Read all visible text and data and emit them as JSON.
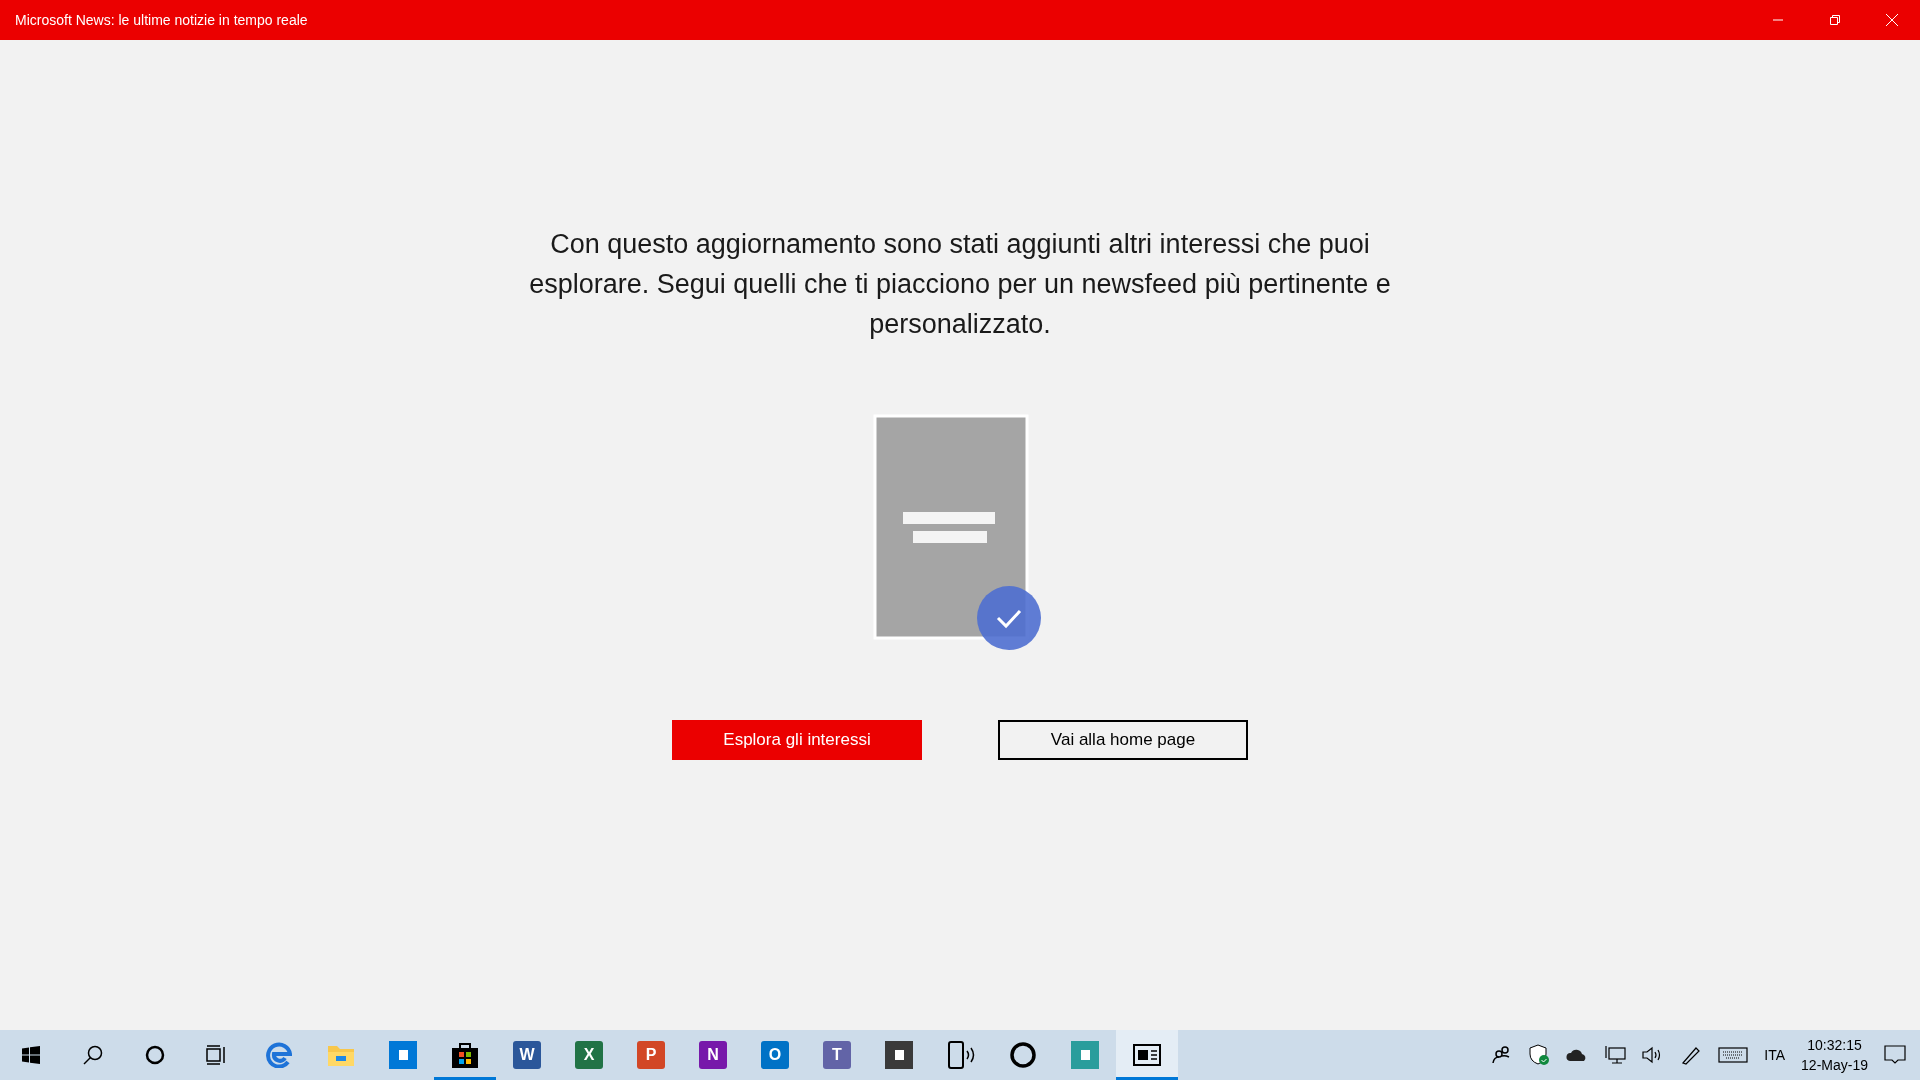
{
  "window": {
    "title": "Microsoft News: le ultime notizie in tempo reale"
  },
  "message": "Con questo aggiornamento sono stati aggiunti altri interessi che puoi esplorare. Segui quelli che ti piacciono per un newsfeed più pertinente e personalizzato.",
  "buttons": [
    {
      "kind": "primary",
      "label": "Esplora gli interessi"
    },
    {
      "kind": "outline",
      "label": "Vai alla home page"
    }
  ],
  "taskbar": {
    "apps": [
      {
        "kind": "start",
        "running": false,
        "selected": false
      },
      {
        "kind": "search",
        "running": false,
        "selected": false
      },
      {
        "kind": "cortana",
        "running": false,
        "selected": false
      },
      {
        "kind": "taskview",
        "running": false,
        "selected": false
      },
      {
        "kind": "edge",
        "running": false,
        "selected": false
      },
      {
        "kind": "folder",
        "running": false,
        "selected": false
      },
      {
        "kind": "tile",
        "color": "#0078d7",
        "running": false,
        "selected": false
      },
      {
        "kind": "store",
        "running": true,
        "selected": false
      },
      {
        "kind": "letter",
        "letter": "W",
        "color": "#2b579a",
        "running": false,
        "selected": false
      },
      {
        "kind": "letter",
        "letter": "X",
        "color": "#217346",
        "running": false,
        "selected": false
      },
      {
        "kind": "letter",
        "letter": "P",
        "color": "#d24726",
        "running": false,
        "selected": false
      },
      {
        "kind": "letter",
        "letter": "N",
        "color": "#7719aa",
        "running": false,
        "selected": false
      },
      {
        "kind": "letter",
        "letter": "O",
        "color": "#0072c6",
        "running": false,
        "selected": false
      },
      {
        "kind": "letter",
        "letter": "T",
        "color": "#6264a7",
        "running": false,
        "selected": false
      },
      {
        "kind": "tile",
        "color": "#3a3a3a",
        "running": false,
        "selected": false
      },
      {
        "kind": "phone",
        "running": false,
        "selected": false
      },
      {
        "kind": "ring",
        "running": false,
        "selected": false
      },
      {
        "kind": "tile",
        "color": "#2a9d9c",
        "running": false,
        "selected": false
      },
      {
        "kind": "news",
        "running": true,
        "selected": true
      }
    ],
    "language": "ITA",
    "time": "10:32:15",
    "date": "12-May-19"
  }
}
